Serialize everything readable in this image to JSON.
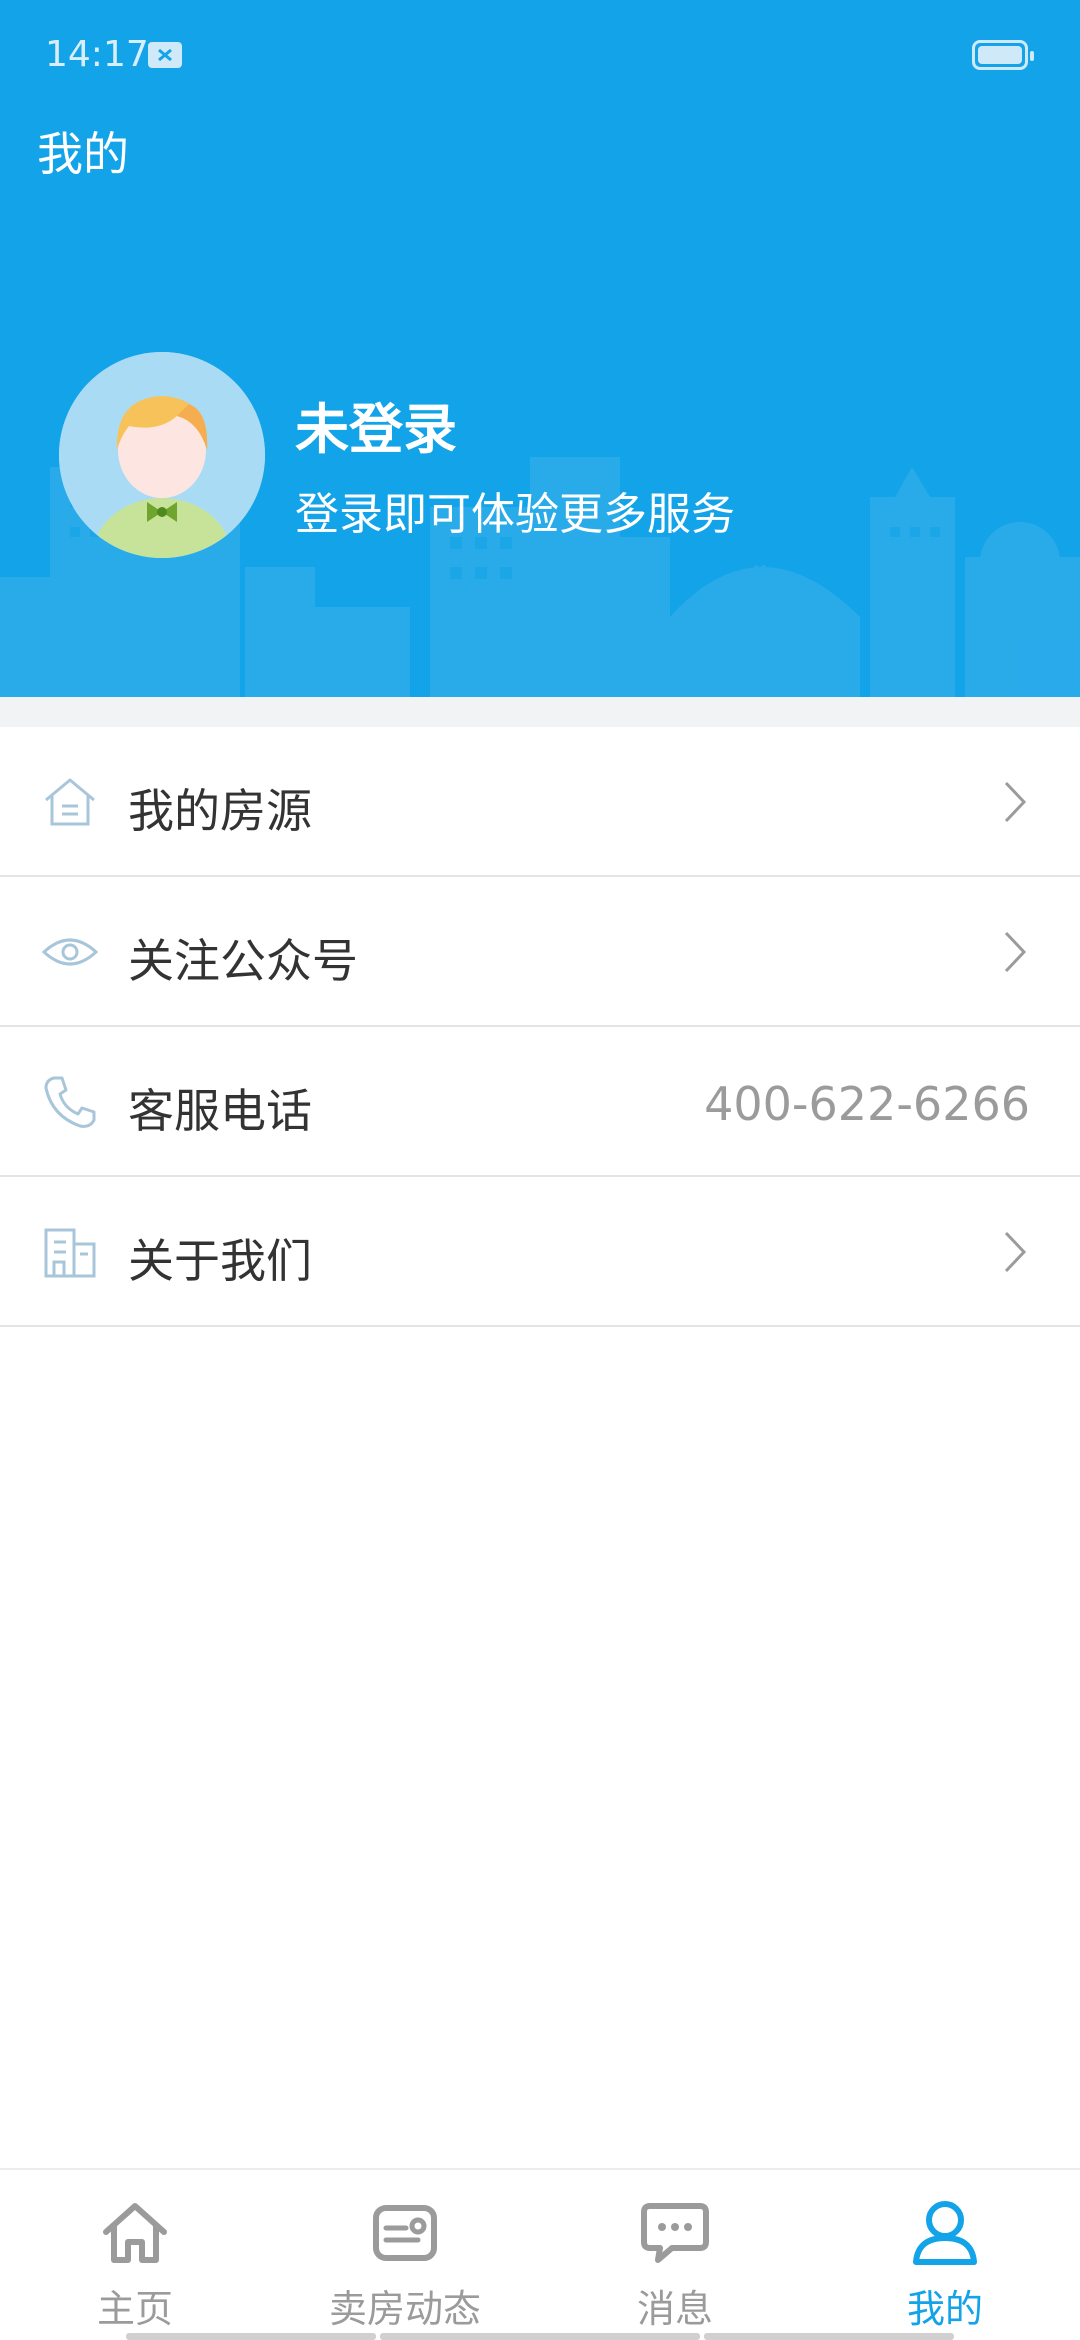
{
  "status_bar": {
    "time": "14:17"
  },
  "header": {
    "title": "我的",
    "login_title": "未登录",
    "login_subtitle": "登录即可体验更多服务"
  },
  "menu": [
    {
      "icon": "house-icon",
      "label": "我的房源",
      "value": "",
      "arrow": true
    },
    {
      "icon": "eye-icon",
      "label": "关注公众号",
      "value": "",
      "arrow": true
    },
    {
      "icon": "phone-icon",
      "label": "客服电话",
      "value": "400-622-6266",
      "arrow": false
    },
    {
      "icon": "building-icon",
      "label": "关于我们",
      "value": "",
      "arrow": true
    }
  ],
  "tabbar": {
    "items": [
      {
        "icon": "home-icon",
        "label": "主页"
      },
      {
        "icon": "news-card-icon",
        "label": "卖房动态"
      },
      {
        "icon": "chat-bubble-icon",
        "label": "消息"
      },
      {
        "icon": "user-icon",
        "label": "我的"
      }
    ],
    "active_index": 3
  },
  "colors": {
    "primary": "#12a3e8",
    "text": "#333333",
    "muted": "#9b9b9b",
    "icon": "#a8c6da"
  }
}
